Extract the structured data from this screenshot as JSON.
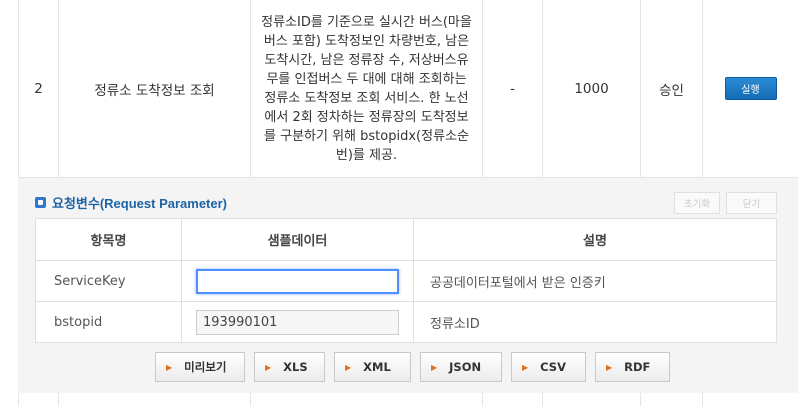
{
  "api_row": {
    "number": "2",
    "name": "정류소 도착정보 조회",
    "description_lines": [
      "정류소ID를 기준으로 실시간 버스(마을",
      "버스 포함) 도착정보인 차량번호, 남은",
      "도착시간, 남은 정류장 수, 저상버스유",
      "무를 인접버스 두 대에 대해 조회하는",
      "정류소 도착정보 조회 서비스. 한 노선",
      "에서 2회 정차하는 정류장의 도착정보",
      "를 구분하기 위해 bstopidx(정류소순",
      "번)를 제공."
    ],
    "traffic": "-",
    "limit": "1000",
    "approval": "승인",
    "run_label": "실행"
  },
  "panel": {
    "title": "요청변수(Request Parameter)",
    "reset_label": "초기화",
    "close_label": "닫기",
    "headers": [
      "항목명",
      "샘플데이터",
      "설명"
    ],
    "params": [
      {
        "name": "ServiceKey",
        "value": "",
        "description": "공공데이터포털에서 받은 인증키"
      },
      {
        "name": "bstopid",
        "value": "193990101",
        "description": "정류소ID"
      }
    ]
  },
  "formats": [
    {
      "label": "미리보기",
      "width": 90
    },
    {
      "label": "XLS",
      "width": 71
    },
    {
      "label": "XML",
      "width": 77
    },
    {
      "label": "JSON",
      "width": 82
    },
    {
      "label": "CSV",
      "width": 75
    },
    {
      "label": "RDF",
      "width": 75
    }
  ],
  "colors": {
    "accent": "#1e63a6",
    "run_button": "#1b77c5",
    "arrow": "#e0701a"
  }
}
